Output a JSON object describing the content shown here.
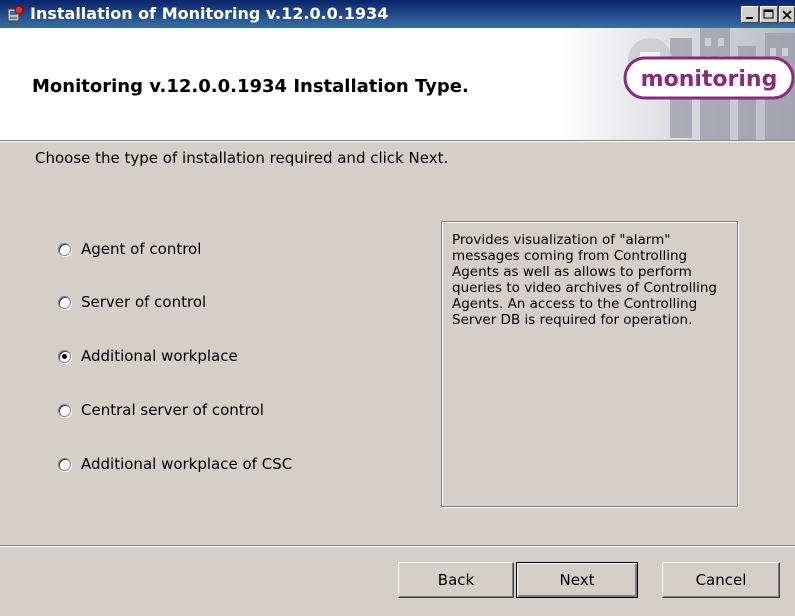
{
  "window": {
    "title": "Installation of Monitoring v.12.0.0.1934"
  },
  "banner": {
    "title": "Monitoring v.12.0.0.1934 Installation Type.",
    "logo_text": "monitoring"
  },
  "instruction": "Choose the type of installation required and click Next.",
  "options": [
    {
      "label": "Agent of control",
      "checked": false
    },
    {
      "label": "Server of control",
      "checked": false
    },
    {
      "label": "Additional workplace",
      "checked": true
    },
    {
      "label": "Central server of control",
      "checked": false
    },
    {
      "label": "Additional workplace of CSC",
      "checked": false
    }
  ],
  "description": "Provides visualization of \"alarm\" messages coming from Controlling Agents as well as allows to perform queries to video archives of Controlling Agents. An access to the Controlling Server DB is required for operation.",
  "buttons": {
    "back": "Back",
    "next": "Next",
    "cancel": "Cancel"
  },
  "colors": {
    "titlebar": "#0a246a",
    "logo_accent": "#8a2a7a",
    "dialog_bg": "#d4d0c8"
  }
}
